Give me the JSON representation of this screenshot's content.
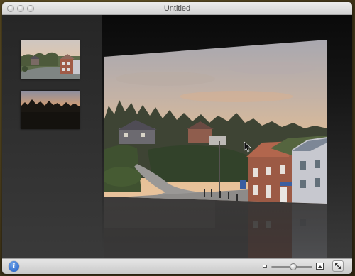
{
  "window": {
    "title": "Untitled"
  },
  "icons": {
    "close": "window-close-button",
    "minimize": "window-minimize-button",
    "zoom": "window-zoom-button",
    "info": "info-icon",
    "zoom_small": "small-image-icon",
    "zoom_large": "large-image-icon",
    "fullscreen": "expand-arrows-icon"
  },
  "thumbnails": [
    {
      "subject": "street-houses-photo"
    },
    {
      "subject": "sunset-treeline-photo"
    }
  ],
  "bottombar": {
    "info_label": "i",
    "zoom_level": 0.55
  },
  "colors": {
    "sky_warm": "#e8b98a",
    "sky_cool": "#a9a7b2",
    "brick": "#9c5a45",
    "info_blue": "#1f5cc4"
  }
}
